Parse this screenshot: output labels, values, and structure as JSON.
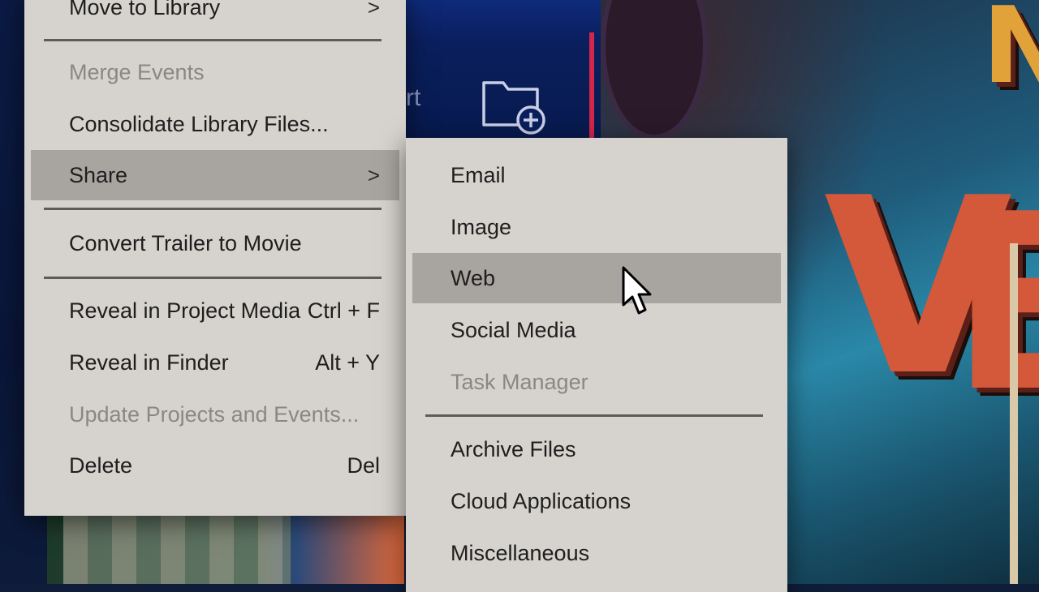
{
  "background": {
    "app_strip_partial_text": "rt",
    "poster_letters": [
      "N",
      "V",
      "E"
    ]
  },
  "main_menu": {
    "items": [
      {
        "label": "Move to Library",
        "shortcut": "",
        "submenu": true,
        "disabled": false
      },
      {
        "label": "Merge Events",
        "shortcut": "",
        "submenu": false,
        "disabled": true
      },
      {
        "label": "Consolidate Library Files...",
        "shortcut": "",
        "submenu": false,
        "disabled": false
      },
      {
        "label": "Share",
        "shortcut": "",
        "submenu": true,
        "disabled": false,
        "highlighted": true
      },
      {
        "label": "Convert Trailer to Movie",
        "shortcut": "",
        "submenu": false,
        "disabled": false
      },
      {
        "label": "Reveal in Project Media",
        "shortcut": "Ctrl + F",
        "submenu": false,
        "disabled": false
      },
      {
        "label": "Reveal in Finder",
        "shortcut": "Alt + Y",
        "submenu": false,
        "disabled": false
      },
      {
        "label": "Update Projects and Events...",
        "shortcut": "",
        "submenu": false,
        "disabled": true
      },
      {
        "label": "Delete",
        "shortcut": "Del",
        "submenu": false,
        "disabled": false
      }
    ],
    "submenu_arrow": ">"
  },
  "share_submenu": {
    "items": [
      {
        "label": "Email",
        "disabled": false
      },
      {
        "label": "Image",
        "disabled": false
      },
      {
        "label": "Web",
        "disabled": false,
        "highlighted": true
      },
      {
        "label": "Social Media",
        "disabled": false
      },
      {
        "label": "Task Manager",
        "disabled": true
      },
      {
        "label": "Archive Files",
        "disabled": false
      },
      {
        "label": "Cloud Applications",
        "disabled": false
      },
      {
        "label": "Miscellaneous",
        "disabled": false
      }
    ]
  },
  "colors": {
    "menu_bg": "#d6d3ce",
    "highlight": "#a8a5a1",
    "disabled_text": "#8a8784",
    "accent_red": "#d4264a"
  }
}
